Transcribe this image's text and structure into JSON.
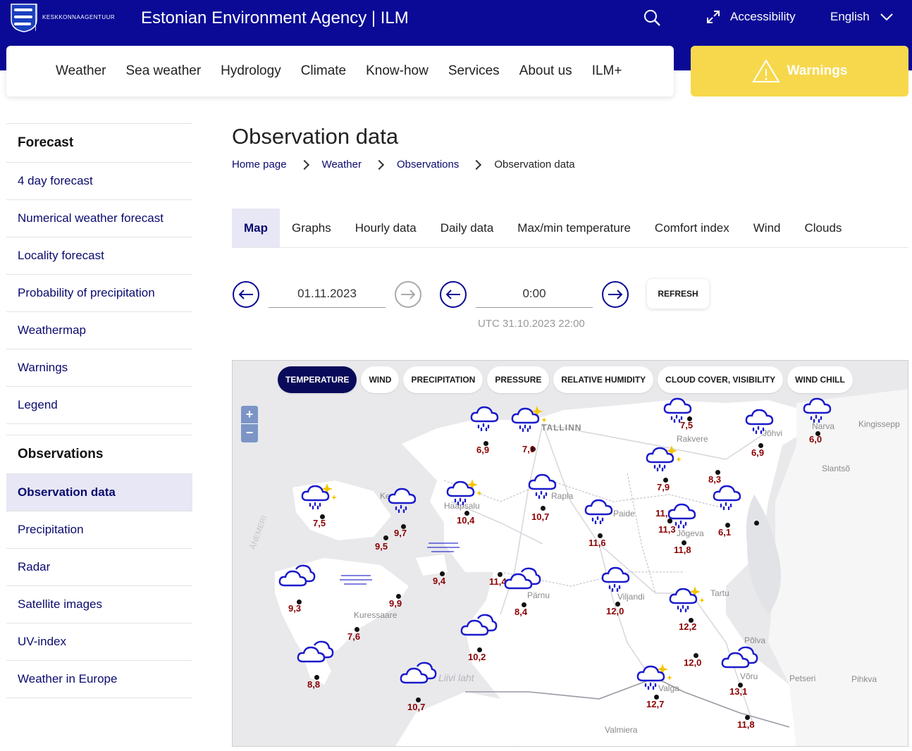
{
  "header": {
    "logo_text": "KESKKONNAAGENTUUR",
    "title": "Estonian Environment Agency | ILM",
    "accessibility": "Accessibility",
    "language": "English"
  },
  "nav": [
    "Weather",
    "Sea weather",
    "Hydrology",
    "Climate",
    "Know-how",
    "Services",
    "About us",
    "ILM+"
  ],
  "warnings_label": "Warnings",
  "sidebar": {
    "forecast_heading": "Forecast",
    "forecast_items": [
      "4 day forecast",
      "Numerical weather forecast",
      "Locality forecast",
      "Probability of precipitation",
      "Weathermap",
      "Warnings",
      "Legend"
    ],
    "observations_heading": "Observations",
    "observation_items": [
      "Observation data",
      "Precipitation",
      "Radar",
      "Satellite images",
      "UV-index",
      "Weather in Europe"
    ]
  },
  "page_title": "Observation data",
  "breadcrumb": [
    "Home page",
    "Weather",
    "Observations",
    "Observation data"
  ],
  "tabs": [
    "Map",
    "Graphs",
    "Hourly data",
    "Daily data",
    "Max/min temperature",
    "Comfort index",
    "Wind",
    "Clouds"
  ],
  "controls": {
    "date": "01.11.2023",
    "time": "0:00",
    "refresh": "REFRESH",
    "utc": "UTC 31.10.2023 22:00"
  },
  "map": {
    "layers": [
      "TEMPERATURE",
      "WIND",
      "PRECIPITATION",
      "PRESSURE",
      "RELATIVE HUMIDITY",
      "CLOUD COVER, VISIBILITY",
      "WIND CHILL"
    ],
    "zoom_in": "+",
    "zoom_out": "−",
    "places": [
      "TALLINN",
      "Rakvere",
      "Jõhvi",
      "Narva",
      "Kingissepp",
      "Slantsõ",
      "Haapsalu",
      "Rapla",
      "Paide",
      "Jõgeva",
      "Pärnu",
      "Viljandi",
      "Tartu",
      "Kuressaare",
      "Põlva",
      "Võru",
      "Petseri",
      "Pihkva",
      "Valga",
      "Valmiera",
      "Liivi laht",
      "Ke",
      "ÄNEMERI"
    ],
    "observations": [
      "7,5",
      "6,9",
      "7,0",
      "6,9",
      "6,0",
      "7,9",
      "8,3",
      "7,5",
      "9,7",
      "10,4",
      "10,7",
      "11,6",
      "11,0",
      "11,3",
      "11,8",
      "6,1",
      "9,5",
      "9,4",
      "11,4",
      "9,3",
      "9,9",
      "8,4",
      "12,0",
      "12,2",
      "7,6",
      "10,2",
      "12,0",
      "8,8",
      "10,7",
      "12,7",
      "13,1",
      "11,8"
    ]
  },
  "colors": {
    "header_bg": "#0a0a96",
    "warning_bg": "#f7d84d",
    "active_bg": "#e7e7f5",
    "value_color": "#8b0000",
    "icon_color": "#1a1acc"
  }
}
